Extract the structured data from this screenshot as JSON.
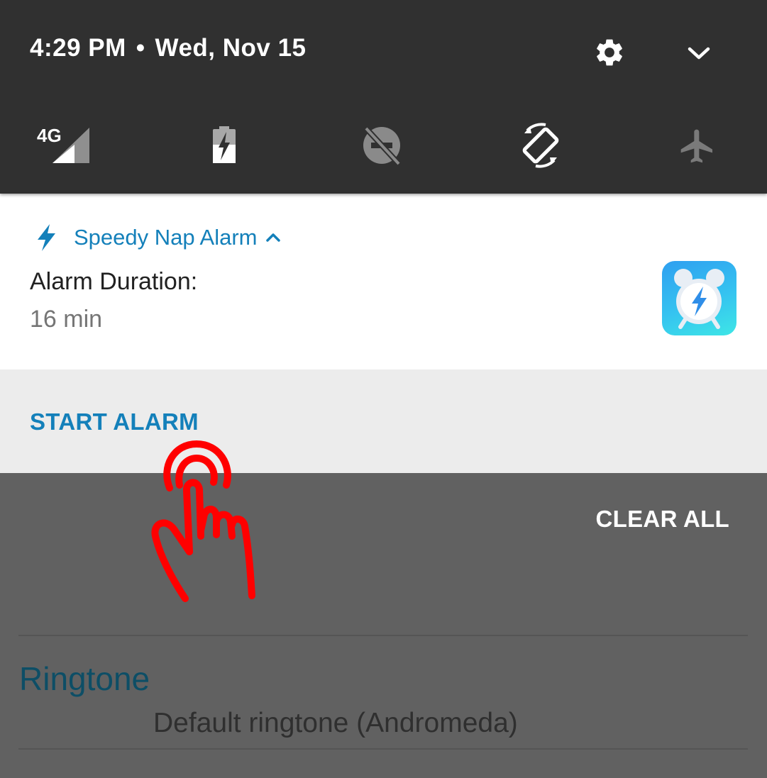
{
  "status_bar": {
    "time": "4:29 PM",
    "separator": "•",
    "date": "Wed, Nov 15",
    "icons": [
      "gear-icon",
      "chevron-down-icon"
    ]
  },
  "quick_settings": {
    "network_label": "4G",
    "tiles": [
      "signal-4g-icon",
      "battery-charging-icon",
      "do-not-disturb-off-icon",
      "auto-rotate-icon",
      "airplane-mode-icon"
    ]
  },
  "notification": {
    "app_name": "Speedy Nap Alarm",
    "title": "Alarm Duration:",
    "text": "16 min",
    "action": "START ALARM",
    "accent_color": "#1480ba"
  },
  "clear_all": "CLEAR ALL",
  "background_app": {
    "section_title": "Ringtone",
    "section_value": "Default ringtone (Andromeda)"
  },
  "overlay": {
    "icon": "tap-hand-icon",
    "color": "#ff0000"
  }
}
